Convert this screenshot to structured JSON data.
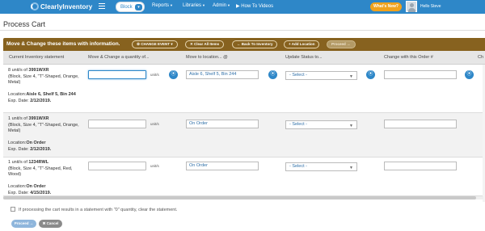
{
  "header": {
    "logo_text": "ClearlyInventory",
    "block_label": "Block",
    "nav": [
      {
        "label": "Reports",
        "icon": "caret-down-icon"
      },
      {
        "label": "Libraries",
        "icon": "caret-down-icon"
      },
      {
        "label": "Admin",
        "icon": "caret-down-icon"
      },
      {
        "label": "How To Videos",
        "icon": "video-icon"
      }
    ],
    "whats_new": "What's New?",
    "user_name": "Hello Steve",
    "bar_color": "#2e87c8",
    "accent_color": "#f0a21d"
  },
  "page": {
    "title": "Process Cart"
  },
  "banner": {
    "text": "Move & Change these items with information.",
    "color": "#87621f",
    "buttons": {
      "change_event": "CHANGE EVENT",
      "clear_all": "Clear All Items",
      "back": "Back To Inventory",
      "add_location": "Add Location",
      "proceed": "Proceed"
    }
  },
  "table": {
    "headers": {
      "statement": "Current Inventory statement",
      "quantity": "Move & Change a quantity of...",
      "location": "Move to location... @",
      "status": "Update Status to...",
      "order": "Change with this Order #",
      "extra": "Ch"
    },
    "unit_suffix": "unit/s",
    "select_placeholder": "- Select -",
    "rows": [
      {
        "qty_prefix": "8 unit/s of",
        "sku": "3991WXR",
        "desc": "(Block, Size 4, \"T\"-Shaped, Orange, Metal)",
        "location_label": "Location:",
        "location": "Aisle 6, Shelf 5, Bin 244",
        "exp_label": "Exp. Date:",
        "exp": "2/12/2019.",
        "move_to": "Aisle 6, Shelf 5, Bin 244"
      },
      {
        "qty_prefix": "1 unit/s of",
        "sku": "3991WXR",
        "desc": "(Block, Size 4, \"T\"-Shaped, Orange, Metal)",
        "location_label": "Location:",
        "location": "On Order",
        "exp_label": "Exp. Date:",
        "exp": "2/12/2019.",
        "move_to": "On Order"
      },
      {
        "qty_prefix": "1 unit/s of",
        "sku": "1234RWL",
        "desc": "(Block, Size 4, \"T\"-Shaped, Red, Wood)",
        "location_label": "Location:",
        "location": "On Order",
        "exp_label": "Exp. Date:",
        "exp": "4/15/2019.",
        "move_to": "On Order"
      }
    ]
  },
  "footer": {
    "zero_qty_text": "If processing the cart results in a statement with \"0\" quantity, clear the statement.",
    "proceed": "Proceed",
    "cancel": "Cancel"
  }
}
